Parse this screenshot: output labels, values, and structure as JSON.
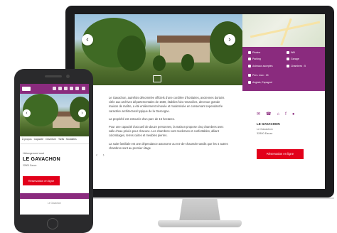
{
  "desktop": {
    "hero": {
      "prev_label": "‹",
      "next_label": "›"
    },
    "info_box": {
      "items": [
        {
          "icon": "home-icon",
          "label": "Piscine"
        },
        {
          "icon": "wifi-icon",
          "label": "Wifi"
        },
        {
          "icon": "parking-icon",
          "label": "Parking"
        },
        {
          "icon": "garage-icon",
          "label": "Garage"
        },
        {
          "icon": "pets-icon",
          "label": "Animaux acceptés"
        },
        {
          "icon": "rooms-icon",
          "label": "Chambres : 5"
        },
        {
          "icon": "guests-icon",
          "label": "Pers. max : 15"
        },
        {
          "icon": "tag-icon",
          "label": "Anglais, Espagnol"
        }
      ]
    },
    "description": [
      "Le Gavachon, autrefois dénommée officiels d'une cordière d'hortiaires, anciennes dortoirs citée aux archives départementales de 1660, établies fois remaniées, devenue grande maison de maître, a été entièrement rénovée et modernisée en conservant cependant le caractère architectural typique de la Gascogne.",
      "La propriété est entourée d'un parc de 15 hectares.",
      "Pour une capacité d'accueil de douze personnes, la maison propose cinq chambres avec salle d'eau privée pour chacune. Les chambres sont modernes et confortables, alliant colombages, terres cuites et meubles pierres.",
      "La suite familiale est une dépendance autonome au rez-de-chaussée tandis que les 4 autres chambres sont au premier étage"
    ],
    "side_title": "LE GAVACHON",
    "side_address": [
      "Le Gavachon",
      "32800 Eauze"
    ],
    "book_button": "Réservation en ligne",
    "arrows": "‹ ›"
  },
  "mobile": {
    "prev_label": "‹",
    "next_label": "›",
    "tabs": [
      "À propos",
      "Capacité",
      "Ouverture",
      "Tarifs",
      "Modalités"
    ],
    "kicker": "Hébergement rural",
    "title": "LE GAVACHON",
    "city": "32800 Eauze",
    "book_button": "Réservation en ligne",
    "footer_text": "Le Gavachon"
  },
  "colors": {
    "brand_purple": "#8a2b7e",
    "accent_red": "#e2001a",
    "frame": "#1c1c1e"
  }
}
